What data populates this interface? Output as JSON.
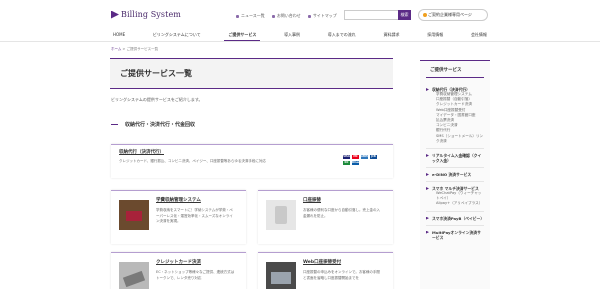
{
  "header": {
    "logo_text": "Billing System",
    "util": [
      "ニュース一覧",
      "お問い合わせ",
      "サイトマップ"
    ],
    "search_placeholder": "",
    "search_button": "検索",
    "contact_button": "ご契約企業様専用ページ"
  },
  "nav": [
    {
      "label": "HOME",
      "active": false
    },
    {
      "label": "ビリングシステムについて",
      "active": false
    },
    {
      "label": "ご提供サービス",
      "active": true
    },
    {
      "label": "導入事例",
      "active": false
    },
    {
      "label": "導入までの流れ",
      "active": false
    },
    {
      "label": "資料請求",
      "active": false
    },
    {
      "label": "採用情報",
      "active": false
    },
    {
      "label": "会社情報",
      "active": false
    }
  ],
  "breadcrumb": {
    "home": "ホーム",
    "sep": " > ",
    "current": "ご提供サービス一覧"
  },
  "page_title": "ご提供サービス一覧",
  "intro": "ビリングシステムの提供サービスをご紹介します。",
  "section_title": "収納代行・決済代行・代金回収",
  "main_card": {
    "title": "収納代行（決済代行）",
    "desc": "クレジットカード、銀行振込、コンビニ決済、ペイジー、口座振替等あらゆる決済手段に対応",
    "logos": [
      "VISA",
      "MC",
      "AMEX",
      "JCB",
      "DC",
      "Diners"
    ]
  },
  "cards": [
    {
      "title": "学費収納管理システム",
      "desc": "学費収納をスマートに！学納システムが学費・ペーパーレス化・運営効率化・スムーズなオンライン決済を実現。"
    },
    {
      "title": "口座振替",
      "desc": "お客様の便利な口座から自動引落し。売上金の入金漏れを防止。"
    },
    {
      "title": "クレジットカード決済",
      "desc": "EC・ネットショップ等様々なご提供、連続方式はトークンで、レンタ売り対応"
    },
    {
      "title": "Web口座振替受付",
      "desc": "口座振替の申込みをオンラインで。お客様の手間と書面を省略し口座振替開始までを"
    }
  ],
  "sidebar": {
    "title": "ご提供サービス",
    "groups": [
      {
        "label": "収納代行（決済代行）",
        "subs": [
          "学費収納管理システム",
          "口座振替（自動引落）",
          "クレジットカード決済",
          "Web口座振替受付",
          "マイデータ・図書館口座",
          "払込票決済",
          "コンビニ決済",
          "銀行代行",
          "SMS（ショートメール）リンク決済"
        ]
      },
      {
        "label": "リアルタイム入金確認（クイック入金）",
        "subs": []
      },
      {
        "label": "e-DINO 決済サービス",
        "subs": []
      },
      {
        "label": "スマホ マルチ決済サービス",
        "subs": [
          "WeChatPay（ウィーチャットペイ）",
          "Alipay+（アリペイプラス）"
        ]
      },
      {
        "label": "スマホ決済PayB（ペイビー）",
        "subs": []
      },
      {
        "label": "MultiPayオンライン決済サービス",
        "subs": []
      }
    ]
  },
  "colors": {
    "accent": "#5b2a86",
    "accent_light": "#b59ed0"
  }
}
